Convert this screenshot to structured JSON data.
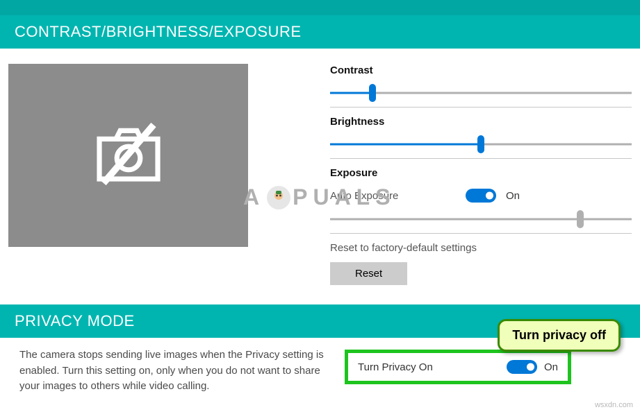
{
  "top_bar_color": "#00a7a3",
  "section1": {
    "title": "CONTRAST/BRIGHTNESS/EXPOSURE",
    "preview_icon": "camera-off-icon",
    "controls": {
      "contrast": {
        "label": "Contrast",
        "value_pct": 14
      },
      "brightness": {
        "label": "Brightness",
        "value_pct": 50
      },
      "exposure": {
        "label": "Exposure",
        "auto_label": "Auto Exposure",
        "auto_enabled": true,
        "auto_state": "On",
        "slider_pct": 83,
        "slider_disabled": true
      }
    },
    "reset": {
      "description": "Reset to factory-default settings",
      "button": "Reset"
    }
  },
  "section2": {
    "title": "PRIVACY MODE",
    "description": "The camera stops sending live images when the Privacy setting is enabled. Turn this setting on, only when you do not want to share your images to others while video calling.",
    "toggle_label": "Turn Privacy On",
    "toggle_state": "On",
    "toggle_enabled": true
  },
  "callout": "Turn privacy off",
  "watermark": "APPUALS",
  "attribution": "wsxdn.com"
}
